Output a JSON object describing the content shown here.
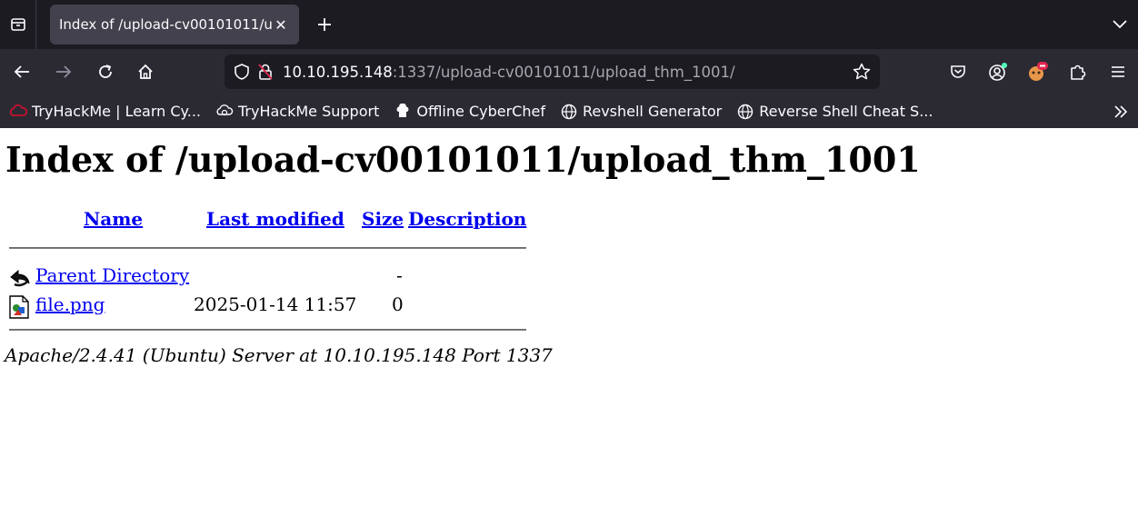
{
  "browser": {
    "tab": {
      "title": "Index of /upload-cv00101011/upload_thm_1001"
    },
    "url": {
      "host": "10.10.195.148",
      "rest": ":1337/upload-cv00101011/upload_thm_1001/"
    },
    "bookmarks": [
      {
        "label": "TryHackMe | Learn Cy...",
        "icon": "tryhackme-icon"
      },
      {
        "label": "TryHackMe Support",
        "icon": "support-icon"
      },
      {
        "label": "Offline CyberChef",
        "icon": "chef-icon"
      },
      {
        "label": "Revshell Generator",
        "icon": "globe-icon"
      },
      {
        "label": "Reverse Shell Cheat S...",
        "icon": "globe-icon"
      }
    ]
  },
  "page": {
    "title": "Index of /upload-cv00101011/upload_thm_1001",
    "columns": {
      "name": "Name",
      "modified": "Last modified",
      "size": "Size",
      "description": "Description"
    },
    "rows": [
      {
        "name": "Parent Directory",
        "modified": "",
        "size": "-",
        "description": "",
        "icon": "back-arrow-icon"
      },
      {
        "name": "file.png",
        "modified": "2025-01-14 11:57",
        "size": "0",
        "description": "",
        "icon": "image-file-icon"
      }
    ],
    "footer": "Apache/2.4.41 (Ubuntu) Server at 10.10.195.148 Port 1337"
  },
  "colors": {
    "chrome_dark": "#1c1b22",
    "chrome": "#2b2a33",
    "tab_active": "#42414d",
    "link": "#0000ee"
  }
}
